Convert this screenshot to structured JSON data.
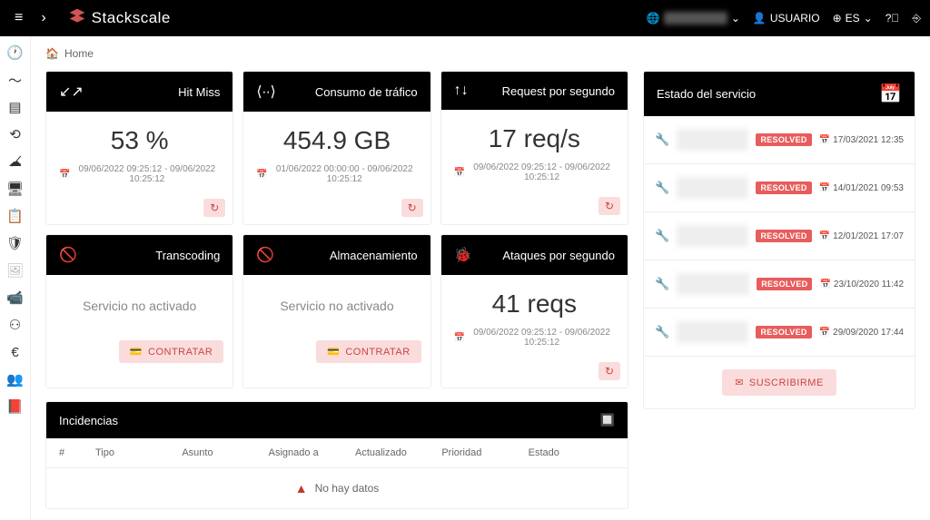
{
  "topbar": {
    "brand": "Stackscale",
    "user_label": "USUARIO",
    "lang_label": "ES"
  },
  "breadcrumb": {
    "home": "Home"
  },
  "cards": {
    "hitmiss": {
      "title": "Hit Miss",
      "value": "53 %",
      "range": "09/06/2022 09:25:12 - 09/06/2022 10:25:12"
    },
    "traffic": {
      "title": "Consumo de tráfico",
      "value": "454.9 GB",
      "range": "01/06/2022 00:00:00 - 09/06/2022 10:25:12"
    },
    "rps": {
      "title": "Request por segundo",
      "value": "17 req/s",
      "range": "09/06/2022 09:25:12 - 09/06/2022 10:25:12"
    },
    "transcoding": {
      "title": "Transcoding",
      "no_service": "Servicio no activado",
      "contract": "CONTRATAR"
    },
    "storage": {
      "title": "Almacenamiento",
      "no_service": "Servicio no activado",
      "contract": "CONTRATAR"
    },
    "attacks": {
      "title": "Ataques por segundo",
      "value": "41 reqs",
      "range": "09/06/2022 09:25:12 - 09/06/2022 10:25:12"
    }
  },
  "incidencias": {
    "title": "Incidencias",
    "cols": {
      "num": "#",
      "tipo": "Tipo",
      "asunto": "Asunto",
      "asignado": "Asignado a",
      "actualizado": "Actualizado",
      "prioridad": "Prioridad",
      "estado": "Estado"
    },
    "empty": "No hay datos"
  },
  "status": {
    "title": "Estado del servicio",
    "resolved_label": "RESOLVED",
    "items": [
      {
        "date": "17/03/2021 12:35"
      },
      {
        "date": "14/01/2021 09:53"
      },
      {
        "date": "12/01/2021 17:07"
      },
      {
        "date": "23/10/2020 11:42"
      },
      {
        "date": "29/09/2020 17:44"
      }
    ],
    "subscribe": "SUSCRIBIRME"
  }
}
